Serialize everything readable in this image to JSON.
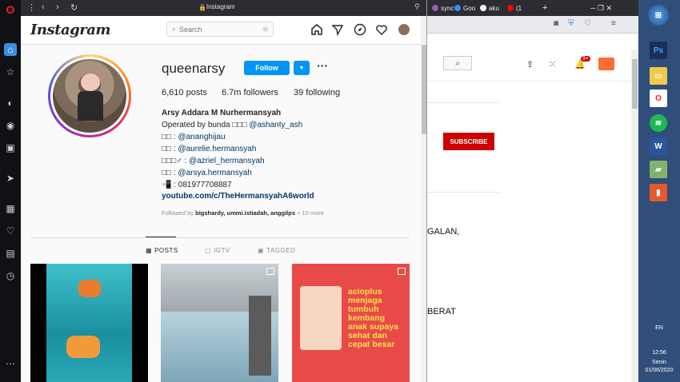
{
  "ig_window": {
    "title": "Instagram",
    "header": {
      "logo": "Instagram",
      "search_placeholder": "Search"
    },
    "profile": {
      "username": "queenarsy",
      "follow_label": "Follow",
      "posts": "6,610 posts",
      "followers": "6.7m followers",
      "following": "39 following",
      "bio_name": "Arsy Addara M Nurhermansyah",
      "bio_lines": [
        {
          "prefix": "Operated by bunda □□□ ",
          "link": "@ashanty_ash"
        },
        {
          "prefix": "□□ : ",
          "link": "@ananghijau"
        },
        {
          "prefix": "□□ : ",
          "link": "@aurelie.hermansyah"
        },
        {
          "prefix": "□□□♂ : ",
          "link": "@azriel_hermansyah"
        },
        {
          "prefix": "□□ : ",
          "link": "@arsya.hermansyah"
        }
      ],
      "phone": "📲 : 081977708887",
      "url": "youtube.com/c/TheHermansyahA6world",
      "followed_by_prefix": "Followed by ",
      "followed_by_names": "bigshardy, ummi.istiadah, anggilps",
      "followed_by_suffix": " + 10 more"
    },
    "tabs": [
      {
        "label": "POSTS",
        "icon": "grid-icon"
      },
      {
        "label": "IGTV",
        "icon": "igtv-icon"
      },
      {
        "label": "TAGGED",
        "icon": "tag-icon"
      }
    ],
    "post3_text": [
      "acioplus",
      "menjaga",
      "tumbuh",
      "kembang",
      "anak supaya",
      "sehat dan",
      "cepat besar"
    ]
  },
  "background_browser": {
    "tabs": [
      "sync",
      "Goo",
      "aku",
      "(1"
    ],
    "subscribe_label": "SUBSCRIBE",
    "text_fragments": [
      "GALAN,",
      "BERAT"
    ],
    "notif_badge": "9+"
  },
  "taskbar": {
    "lang": "EN",
    "time": "12:56",
    "day": "Senin",
    "date": "01/06/2020"
  },
  "colors": {
    "ig_blue": "#0095f6",
    "yt_red": "#cc0000",
    "opera_red": "#ff1b2d"
  }
}
